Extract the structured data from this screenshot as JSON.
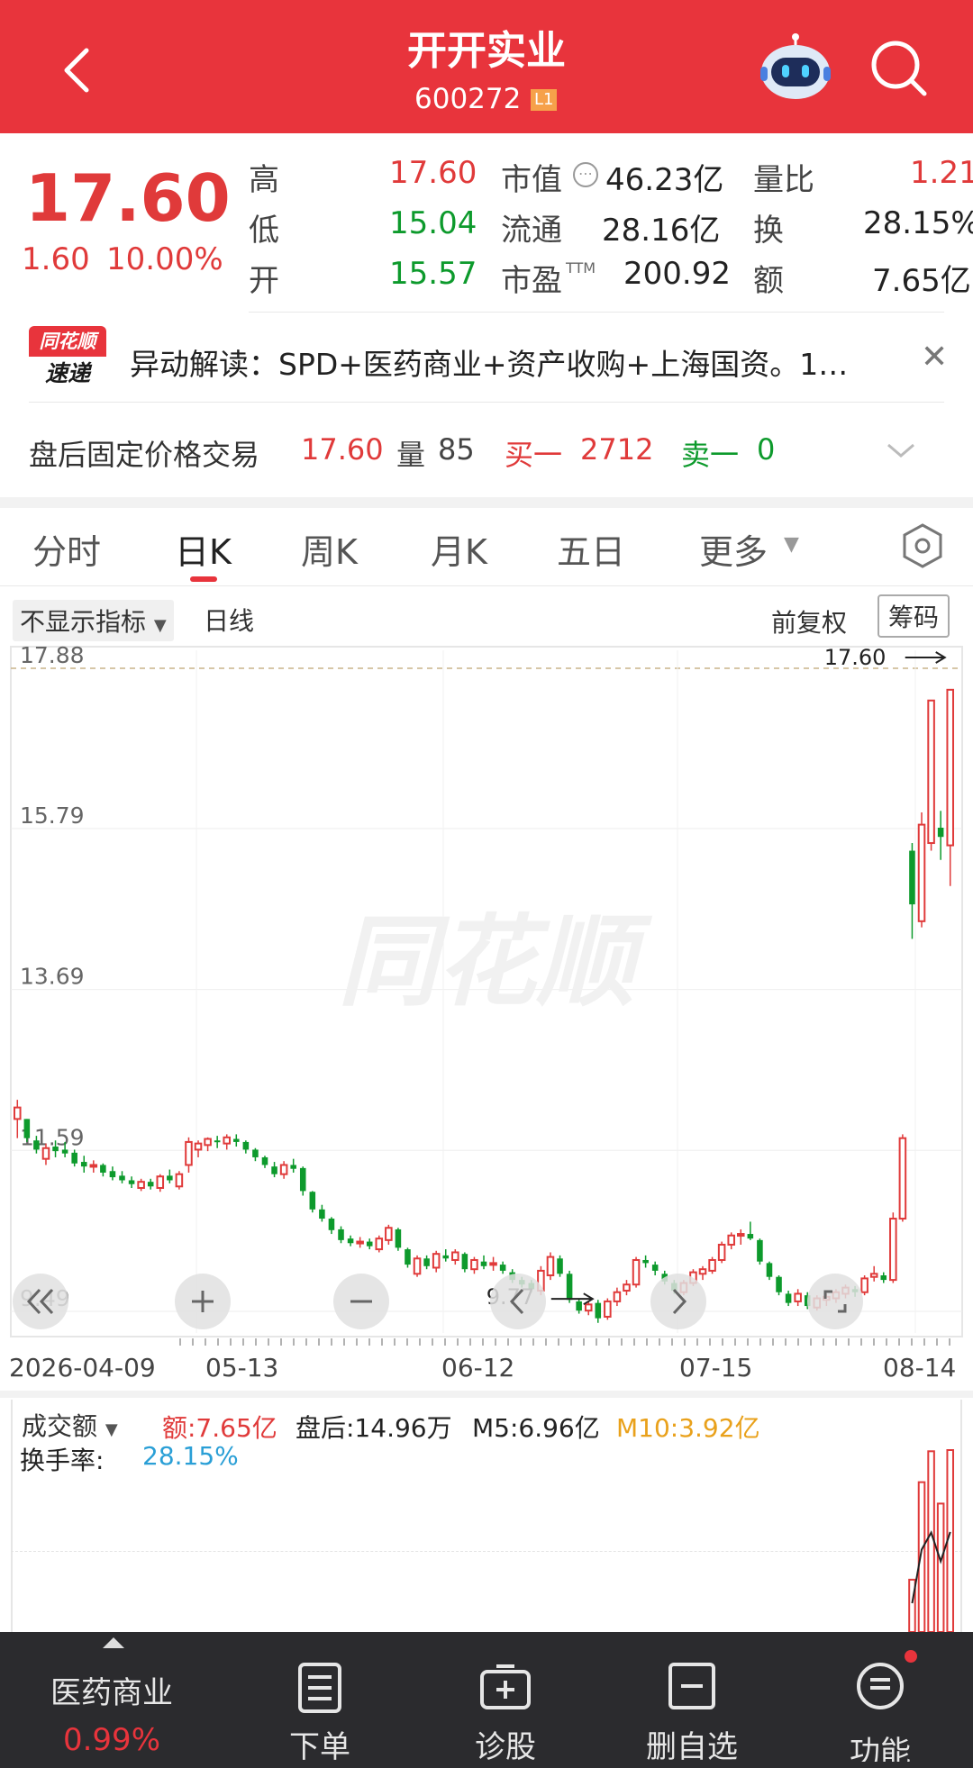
{
  "header": {
    "title": "开开实业",
    "code": "600272",
    "level_badge": "L1"
  },
  "quote": {
    "price": "17.60",
    "change": "1.60",
    "change_pct": "10.00%",
    "rows": [
      {
        "l1": "高",
        "v1": "17.60",
        "l2": "市值",
        "v2": "46.23亿",
        "l3": "量比",
        "v3": "1.21"
      },
      {
        "l1": "低",
        "v1": "15.04",
        "l2": "流通",
        "v2": "28.16亿",
        "l3": "换",
        "v3": "28.15%"
      },
      {
        "l1": "开",
        "v1": "15.57",
        "l2": "市盈",
        "v2": "200.92",
        "l3": "额",
        "v3": "7.65亿"
      }
    ],
    "pe_suffix": "TTM"
  },
  "news": {
    "logo_top": "同花顺",
    "logo_bottom": "速递",
    "text": "异动解读：SPD+医药商业+资产收购+上海国资。1…"
  },
  "after_hours": {
    "label": "盘后固定价格交易",
    "price": "17.60",
    "vol_label": "量",
    "vol": "85",
    "buy_label": "买一",
    "buy": "2712",
    "sell_label": "卖一",
    "sell": "0"
  },
  "tabs": [
    "分时",
    "日K",
    "周K",
    "月K",
    "五日",
    "更多"
  ],
  "chart_toolbar": {
    "indicator": "不显示指标",
    "period": "日线",
    "adjust": "前复权",
    "chips": "筹码"
  },
  "watermark": "同花顺",
  "chart_data": {
    "type": "candlestick",
    "y_ticks": [
      "17.88",
      "15.79",
      "13.69",
      "11.59",
      "9.49"
    ],
    "x_ticks": [
      "2026-04-09",
      "05-13",
      "06-12",
      "07-15",
      "08-14"
    ],
    "high_marker": "17.60",
    "low_marker": "9.77",
    "ylim": [
      9.49,
      17.88
    ],
    "candles": [
      [
        12.0,
        12.25,
        11.75,
        12.15
      ],
      [
        12.0,
        12.0,
        11.7,
        11.75
      ],
      [
        11.72,
        11.78,
        11.55,
        11.6
      ],
      [
        11.48,
        11.68,
        11.4,
        11.62
      ],
      [
        11.64,
        11.72,
        11.5,
        11.58
      ],
      [
        11.6,
        11.7,
        11.5,
        11.55
      ],
      [
        11.56,
        11.6,
        11.38,
        11.42
      ],
      [
        11.44,
        11.52,
        11.3,
        11.38
      ],
      [
        11.38,
        11.46,
        11.3,
        11.4
      ],
      [
        11.4,
        11.42,
        11.25,
        11.3
      ],
      [
        11.32,
        11.38,
        11.2,
        11.24
      ],
      [
        11.26,
        11.32,
        11.16,
        11.2
      ],
      [
        11.2,
        11.25,
        11.1,
        11.15
      ],
      [
        11.1,
        11.22,
        11.06,
        11.18
      ],
      [
        11.18,
        11.22,
        11.08,
        11.12
      ],
      [
        11.1,
        11.28,
        11.05,
        11.25
      ],
      [
        11.26,
        11.34,
        11.16,
        11.2
      ],
      [
        11.12,
        11.32,
        11.08,
        11.28
      ],
      [
        11.4,
        11.76,
        11.3,
        11.7
      ],
      [
        11.6,
        11.72,
        11.5,
        11.68
      ],
      [
        11.66,
        11.76,
        11.58,
        11.74
      ],
      [
        11.72,
        11.78,
        11.62,
        11.7
      ],
      [
        11.68,
        11.8,
        11.6,
        11.76
      ],
      [
        11.74,
        11.8,
        11.64,
        11.7
      ],
      [
        11.7,
        11.72,
        11.55,
        11.6
      ],
      [
        11.6,
        11.62,
        11.45,
        11.5
      ],
      [
        11.5,
        11.52,
        11.36,
        11.4
      ],
      [
        11.38,
        11.44,
        11.24,
        11.28
      ],
      [
        11.28,
        11.45,
        11.22,
        11.4
      ],
      [
        11.4,
        11.48,
        11.3,
        11.35
      ],
      [
        11.36,
        11.38,
        11.0,
        11.06
      ],
      [
        11.05,
        11.06,
        10.78,
        10.82
      ],
      [
        10.82,
        10.88,
        10.66,
        10.7
      ],
      [
        10.7,
        10.72,
        10.5,
        10.55
      ],
      [
        10.56,
        10.6,
        10.38,
        10.42
      ],
      [
        10.44,
        10.48,
        10.34,
        10.38
      ],
      [
        10.38,
        10.46,
        10.32,
        10.4
      ],
      [
        10.4,
        10.44,
        10.3,
        10.34
      ],
      [
        10.3,
        10.48,
        10.26,
        10.44
      ],
      [
        10.42,
        10.62,
        10.36,
        10.58
      ],
      [
        10.56,
        10.58,
        10.28,
        10.32
      ],
      [
        10.3,
        10.32,
        10.06,
        10.1
      ],
      [
        9.98,
        10.22,
        9.94,
        10.18
      ],
      [
        10.18,
        10.22,
        10.04,
        10.08
      ],
      [
        10.06,
        10.28,
        10.0,
        10.24
      ],
      [
        10.22,
        10.3,
        10.14,
        10.18
      ],
      [
        10.16,
        10.3,
        10.1,
        10.26
      ],
      [
        10.24,
        10.26,
        10.0,
        10.04
      ],
      [
        10.04,
        10.2,
        9.98,
        10.16
      ],
      [
        10.14,
        10.22,
        10.04,
        10.08
      ],
      [
        10.1,
        10.2,
        10.02,
        10.12
      ],
      [
        10.1,
        10.14,
        9.98,
        10.02
      ],
      [
        10.0,
        10.04,
        9.86,
        9.9
      ],
      [
        9.9,
        9.94,
        9.8,
        9.84
      ],
      [
        9.86,
        9.9,
        9.74,
        9.78
      ],
      [
        9.76,
        10.08,
        9.7,
        10.02
      ],
      [
        9.96,
        10.26,
        9.9,
        10.2
      ],
      [
        10.18,
        10.22,
        9.94,
        9.98
      ],
      [
        9.98,
        10.02,
        9.6,
        9.64
      ],
      [
        9.62,
        9.66,
        9.46,
        9.5
      ],
      [
        9.5,
        9.62,
        9.44,
        9.58
      ],
      [
        9.6,
        9.64,
        9.34,
        9.4
      ],
      [
        9.42,
        9.66,
        9.38,
        9.62
      ],
      [
        9.62,
        9.8,
        9.56,
        9.74
      ],
      [
        9.76,
        9.9,
        9.7,
        9.84
      ],
      [
        9.84,
        10.2,
        9.8,
        10.16
      ],
      [
        10.16,
        10.22,
        10.06,
        10.12
      ],
      [
        10.1,
        10.14,
        9.96,
        10.02
      ],
      [
        9.98,
        10.02,
        9.84,
        9.88
      ],
      [
        9.86,
        9.9,
        9.72,
        9.76
      ],
      [
        9.74,
        9.9,
        9.7,
        9.86
      ],
      [
        9.86,
        10.04,
        9.82,
        10.0
      ],
      [
        9.98,
        10.08,
        9.9,
        10.04
      ],
      [
        10.02,
        10.2,
        9.98,
        10.16
      ],
      [
        10.16,
        10.4,
        10.12,
        10.36
      ],
      [
        10.36,
        10.52,
        10.3,
        10.48
      ],
      [
        10.48,
        10.56,
        10.36,
        10.5
      ],
      [
        10.5,
        10.66,
        10.42,
        10.44
      ],
      [
        10.42,
        10.44,
        10.1,
        10.14
      ],
      [
        10.12,
        10.14,
        9.9,
        9.94
      ],
      [
        9.94,
        9.96,
        9.7,
        9.74
      ],
      [
        9.72,
        9.76,
        9.56,
        9.6
      ],
      [
        9.62,
        9.78,
        9.56,
        9.72
      ],
      [
        9.7,
        9.74,
        9.52,
        9.56
      ],
      [
        9.54,
        9.7,
        9.5,
        9.66
      ],
      [
        9.64,
        9.72,
        9.56,
        9.68
      ],
      [
        9.66,
        9.78,
        9.6,
        9.74
      ],
      [
        9.72,
        9.84,
        9.66,
        9.8
      ],
      [
        9.78,
        9.82,
        9.68,
        9.74
      ],
      [
        9.74,
        9.96,
        9.7,
        9.92
      ],
      [
        9.94,
        10.08,
        9.88,
        9.98
      ],
      [
        9.96,
        10.0,
        9.86,
        9.9
      ],
      [
        9.9,
        10.78,
        9.86,
        10.7
      ],
      [
        10.7,
        11.8,
        10.66,
        11.75
      ],
      [
        15.5,
        15.6,
        14.35,
        14.8
      ],
      [
        14.58,
        16.0,
        14.5,
        15.84
      ],
      [
        15.6,
        17.46,
        15.5,
        17.46
      ],
      [
        15.8,
        16.02,
        15.38,
        15.68
      ],
      [
        15.57,
        17.6,
        15.04,
        17.6
      ]
    ]
  },
  "volume_panel": {
    "selector": "成交额",
    "amount_label": "额:7.65亿",
    "after_label": "盘后:14.96万",
    "m5": "M5:6.96亿",
    "m10": "M10:3.92亿",
    "turnover_label": "换手率:",
    "turnover": "28.15%",
    "bars": [
      2.2,
      6.3,
      7.6,
      5.4,
      7.65
    ]
  },
  "bottom_bar": {
    "sector": "医药商业",
    "sector_pct": "0.99%",
    "items": [
      "下单",
      "诊股",
      "删自选",
      "功能"
    ]
  },
  "colors": {
    "header_red": "#e8343c",
    "up_red": "#e03a3a",
    "down_green": "#0d9a2c",
    "turnover_blue": "#2a9fd6",
    "m10_orange": "#e9a11b",
    "bottom_bar": "#2b2b2e"
  }
}
